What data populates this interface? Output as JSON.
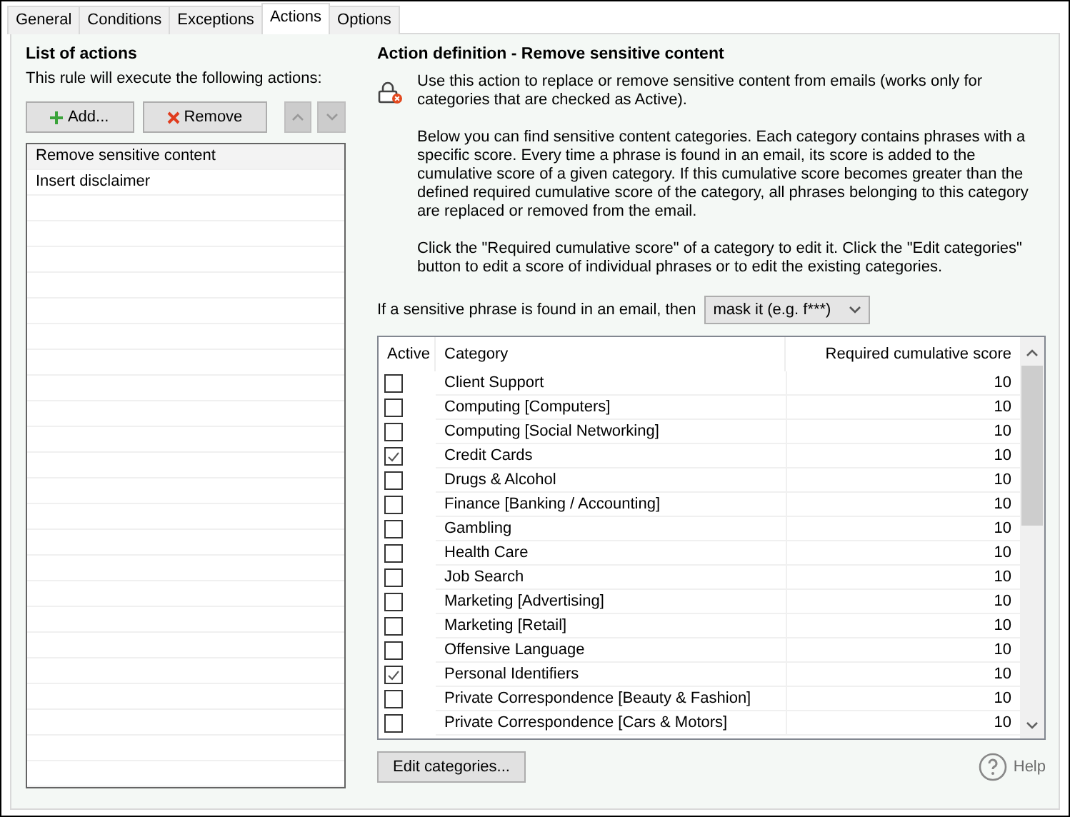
{
  "tabs": [
    {
      "label": "General",
      "selected": false
    },
    {
      "label": "Conditions",
      "selected": false
    },
    {
      "label": "Exceptions",
      "selected": false
    },
    {
      "label": "Actions",
      "selected": true
    },
    {
      "label": "Options",
      "selected": false
    }
  ],
  "actions_panel": {
    "title": "List of actions",
    "subtitle": "This rule will execute the following actions:",
    "buttons": [
      {
        "label": "Add...",
        "kind": "add"
      },
      {
        "label": "Remove",
        "kind": "remove"
      }
    ],
    "move_buttons": [
      {
        "kind": "up",
        "disabled": true
      },
      {
        "kind": "down",
        "disabled": true
      }
    ],
    "items": [
      {
        "label": "Remove sensitive content",
        "selected": true
      },
      {
        "label": "Insert disclaimer",
        "selected": false
      }
    ]
  },
  "definition": {
    "title": "Action definition - Remove sensitive content",
    "paragraphs": [
      "Use this action to replace or remove sensitive content from emails (works only for categories that are checked as Active).",
      "Below you can find sensitive content categories. Each category contains phrases with a specific score. Every time a phrase is found in an email, its score is added to the cumulative score of a given category. If this cumulative score becomes greater than the defined required cumulative score of the category, all phrases belonging to this category are replaced or removed from the email.",
      "Click the \"Required cumulative score\" of a category to edit it. Click the \"Edit categories\" button to edit a score of individual phrases or to edit the existing categories."
    ],
    "mode_label": "If a sensitive phrase is found in an email, then",
    "mode_value": "mask it (e.g. f***)",
    "table": {
      "columns": [
        "Active",
        "Category",
        "Required cumulative score"
      ],
      "rows": [
        {
          "category": "Client Support",
          "score": "10",
          "checked": false
        },
        {
          "category": "Computing [Computers]",
          "score": "10",
          "checked": false
        },
        {
          "category": "Computing [Social  Networking]",
          "score": "10",
          "checked": false
        },
        {
          "category": "Credit Cards",
          "score": "10",
          "checked": true
        },
        {
          "category": "Drugs & Alcohol",
          "score": "10",
          "checked": false
        },
        {
          "category": "Finance [Banking / Accounting]",
          "score": "10",
          "checked": false
        },
        {
          "category": "Gambling",
          "score": "10",
          "checked": false
        },
        {
          "category": "Health Care",
          "score": "10",
          "checked": false
        },
        {
          "category": "Job Search",
          "score": "10",
          "checked": false
        },
        {
          "category": "Marketing [Advertising]",
          "score": "10",
          "checked": false
        },
        {
          "category": "Marketing [Retail]",
          "score": "10",
          "checked": false
        },
        {
          "category": "Offensive Language",
          "score": "10",
          "checked": false
        },
        {
          "category": "Personal Identifiers",
          "score": "10",
          "checked": true
        },
        {
          "category": "Private Correspondence [Beauty & Fashion]",
          "score": "10",
          "checked": false
        },
        {
          "category": "Private Correspondence [Cars & Motors]",
          "score": "10",
          "checked": false
        }
      ]
    },
    "edit_button": "Edit categories...",
    "help": "Help"
  }
}
